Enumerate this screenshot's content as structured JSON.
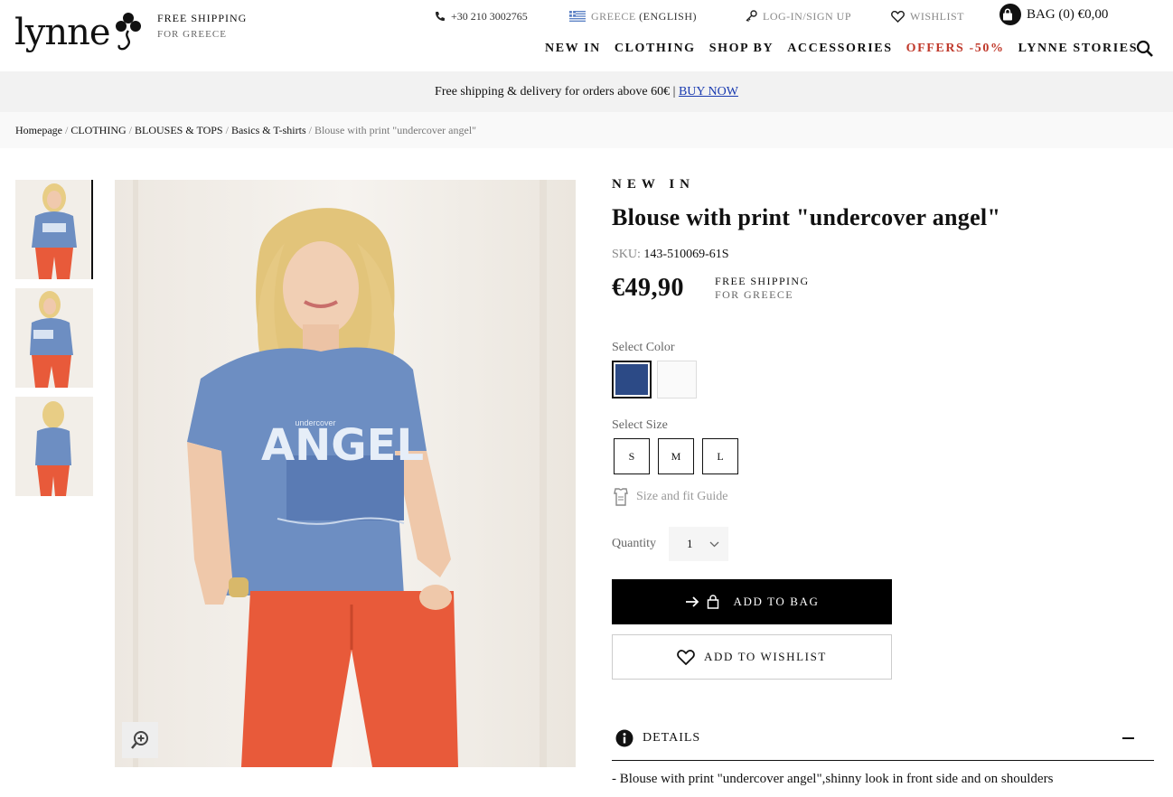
{
  "brand": {
    "name": "lynne"
  },
  "header": {
    "free_shipping_l1": "FREE SHIPPING",
    "free_shipping_l2": "FOR GREECE",
    "phone": "+30 210 3002765",
    "language_country": "GREECE",
    "language_name": "(ENGLISH)",
    "login": "LOG-IN/SIGN UP",
    "wishlist": "WISHLIST",
    "bag": "BAG (0) €0,00"
  },
  "nav": {
    "items": [
      "NEW IN",
      "CLOTHING",
      "SHOP BY",
      "ACCESSORIES",
      "OFFERS -50%",
      "LYNNE STORIES"
    ]
  },
  "promo": {
    "text": "Free shipping & delivery for orders above 60€ |",
    "link": "BUY NOW"
  },
  "breadcrumb": {
    "items": [
      "Homepage",
      "CLOTHING",
      "BLOUSES & TOPS",
      "Basics & T-shirts"
    ],
    "current": "Blouse with print \"undercover angel\""
  },
  "product": {
    "tag": "NEW IN",
    "title": "Blouse with print \"undercover angel\"",
    "sku_label": "SKU:",
    "sku": "143-510069-61S",
    "price": "€49,90",
    "ship_l1": "FREE SHIPPING",
    "ship_l2": "FOR GREECE",
    "select_color_label": "Select Color",
    "colors": [
      "#2c4a86",
      "#fafafa"
    ],
    "select_size_label": "Select Size",
    "sizes": [
      "S",
      "M",
      "L"
    ],
    "fit_guide": "Size and fit Guide",
    "quantity_label": "Quantity",
    "quantity": "1",
    "add_to_bag": "ADD TO BAG",
    "add_to_wishlist": "ADD TO WISHLIST",
    "details_label": "DETAILS",
    "details_text": "-  Blouse with print \"undercover angel\",shinny look in front side and on shoulders"
  },
  "gallery": {
    "print_word": "ANGEL",
    "print_small": "undercover"
  },
  "colors": {
    "offer_red": "#c0392b",
    "link_blue": "#1a3bb0",
    "shirt_blue": "#6d8ec2",
    "pants_red": "#e85a3a"
  }
}
